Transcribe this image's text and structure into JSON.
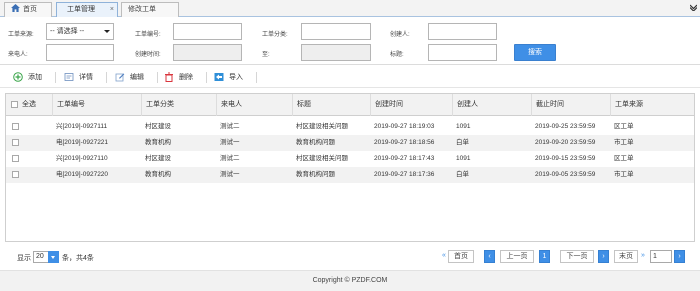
{
  "tabs": [
    {
      "label": "首页",
      "icon": "home-icon"
    },
    {
      "label": "工单管理",
      "closable": true
    },
    {
      "label": "修改工单"
    }
  ],
  "colors": {
    "accent": "#3f8fe6",
    "header_bg": "#f2f2f2",
    "alt_row": "#f2f2f2"
  },
  "form": {
    "source_label": "工单来源:",
    "source_value": "-- 请选择 --",
    "number_label": "工单编号:",
    "category_label": "工单分类:",
    "creator_label": "创建人:",
    "caller_label": "来电人:",
    "created_time_label": "创建时间:",
    "to_label": "至:",
    "title_label": "标题:",
    "search_button": "搜索"
  },
  "toolbar": {
    "add": "添加",
    "detail": "详情",
    "edit": "编辑",
    "delete": "删除",
    "import": "导入"
  },
  "table": {
    "select_all": "全选",
    "columns": [
      "工单编号",
      "工单分类",
      "来电人",
      "标题",
      "创建时间",
      "创建人",
      "截止时间",
      "工单来源"
    ],
    "rows": [
      [
        "兴[2019]-0927111",
        "村区建设",
        "测试二",
        "村区建设相关问题",
        "2019-09-27 18:19:03",
        "1091",
        "2019-09-25 23:59:59",
        "区工单"
      ],
      [
        "电[2019]-0927221",
        "教育机构",
        "测试一",
        "教育机构问题",
        "2019-09-27 18:18:56",
        "白单",
        "2019-09-20 23:59:59",
        "市工单"
      ],
      [
        "兴[2019]-0927110",
        "村区建设",
        "测试二",
        "村区建设相关问题",
        "2019-09-27 18:17:43",
        "1091",
        "2019-09-15 23:59:59",
        "区工单"
      ],
      [
        "电[2019]-0927220",
        "教育机构",
        "测试一",
        "教育机构问题",
        "2019-09-27 18:17:36",
        "白单",
        "2019-09-05 23:59:59",
        "市工单"
      ]
    ]
  },
  "pager": {
    "show_label": "显示",
    "page_size": "20",
    "summary": "条，共4条",
    "first": "首页",
    "prev": "上一页",
    "current": "1",
    "next": "下一页",
    "last": "末页",
    "goto_value": "1"
  },
  "footer": {
    "copyright": "Copyright © PZDF.COM"
  }
}
